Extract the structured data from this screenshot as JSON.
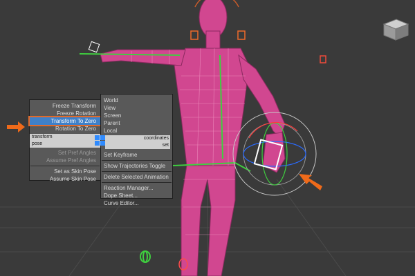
{
  "left_menu": {
    "items": [
      {
        "label": "Freeze Transform",
        "state": "normal"
      },
      {
        "label": "Freeze Rotation",
        "state": "normal"
      },
      {
        "label": "Transform To Zero",
        "state": "highlighted"
      },
      {
        "label": "Rotation To Zero",
        "state": "normal"
      }
    ],
    "quad_labels": [
      "transform",
      "pose"
    ],
    "lower_items": [
      {
        "label": "Set Pref Angles",
        "state": "disabled"
      },
      {
        "label": "Assume Pref Angles",
        "state": "disabled"
      },
      {
        "label": "Set as Skin Pose",
        "state": "normal"
      },
      {
        "label": "Assume Skin Pose",
        "state": "normal"
      }
    ]
  },
  "right_menu": {
    "coord_items": [
      "World",
      "View",
      "Screen",
      "Parent",
      "Local"
    ],
    "quad_labels": [
      "coordinates",
      "set"
    ],
    "anim_items": [
      "Set Keyframe",
      "Show Trajectories Toggle",
      "Delete Selected Animation"
    ],
    "extra_items": [
      "Reaction Manager...",
      "Dope Sheet...",
      "Curve Editor..."
    ]
  },
  "colors": {
    "viewport_bg": "#3a3a3a",
    "grid": "#4a4a4a",
    "character": "#d64a8f",
    "highlight": "#3f80c8",
    "callout_arrow": "#ef6a1a",
    "green_rig": "#3fcf3f"
  }
}
